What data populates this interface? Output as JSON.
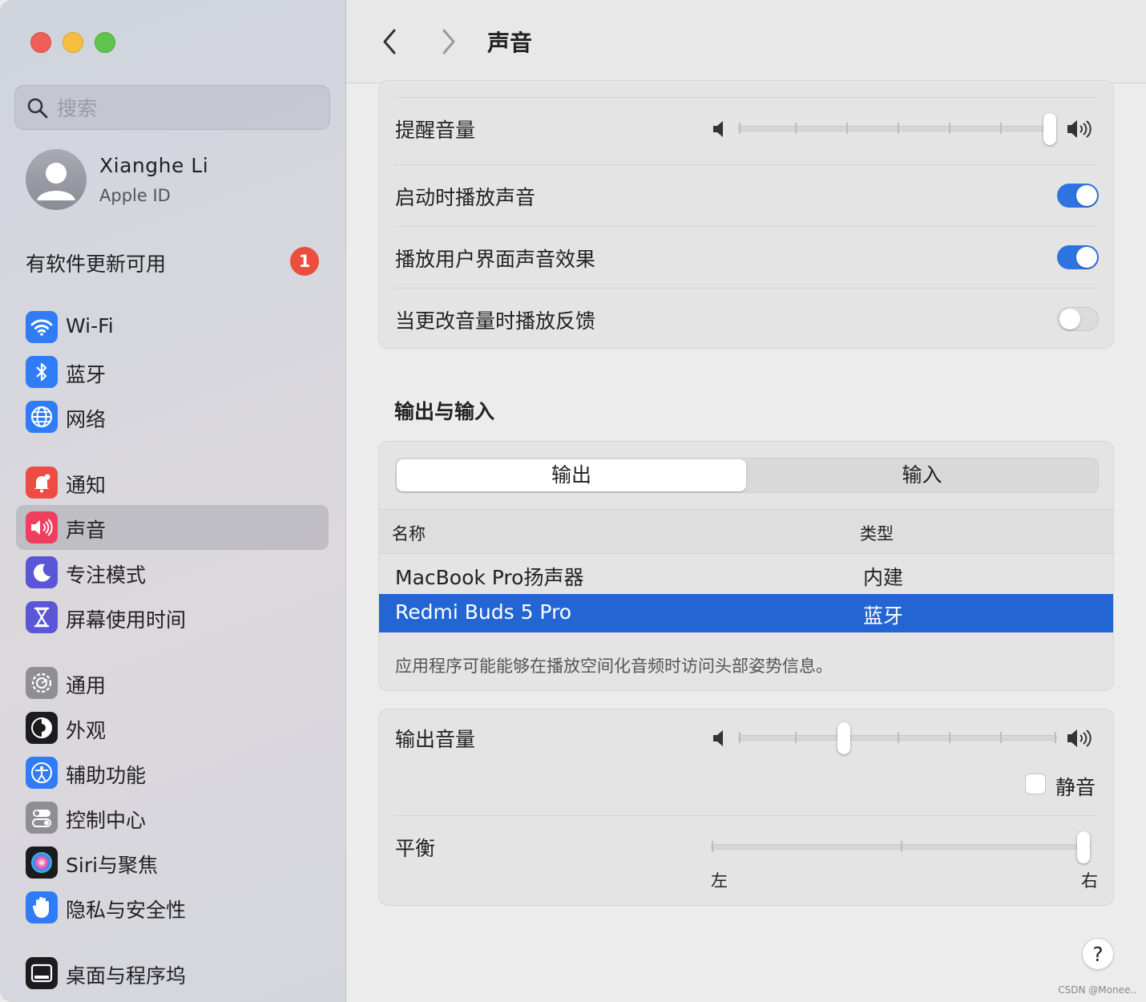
{
  "window": {
    "traffic_lights": [
      "close",
      "minimize",
      "zoom"
    ]
  },
  "sidebar": {
    "search_placeholder": "搜索",
    "account": {
      "name": "Xianghe  Li",
      "subtitle": "Apple ID"
    },
    "update": {
      "label": "有软件更新可用",
      "badge": "1"
    },
    "items": [
      {
        "label": "Wi-Fi",
        "icon": "wifi-icon",
        "color": "#2f7cf6"
      },
      {
        "label": "蓝牙",
        "icon": "bluetooth-icon",
        "color": "#2f7cf6"
      },
      {
        "label": "网络",
        "icon": "globe-icon",
        "color": "#2f7cf6"
      },
      {
        "label": "通知",
        "icon": "bell-icon",
        "color": "#ef4b45"
      },
      {
        "label": "声音",
        "icon": "speaker-icon",
        "color": "#ef3f5f",
        "selected": true
      },
      {
        "label": "专注模式",
        "icon": "moon-icon",
        "color": "#5b56d6"
      },
      {
        "label": "屏幕使用时间",
        "icon": "hourglass-icon",
        "color": "#5b56d6"
      },
      {
        "label": "通用",
        "icon": "gear-icon",
        "color": "#8e8e93"
      },
      {
        "label": "外观",
        "icon": "appearance-icon",
        "color": "#1c1c1e"
      },
      {
        "label": "辅助功能",
        "icon": "accessibility-icon",
        "color": "#2f7cf6"
      },
      {
        "label": "控制中心",
        "icon": "switches-icon",
        "color": "#8e8e93"
      },
      {
        "label": "Siri与聚焦",
        "icon": "siri-icon",
        "color": "#1c1c1e"
      },
      {
        "label": "隐私与安全性",
        "icon": "hand-icon",
        "color": "#2f7cf6"
      },
      {
        "label": "桌面与程序坞",
        "icon": "dock-icon",
        "color": "#1c1c1e"
      }
    ]
  },
  "header": {
    "title": "声音"
  },
  "alerts_card": {
    "alert_volume_label": "提醒音量",
    "alert_volume_level": 1.0,
    "rows": [
      {
        "label": "启动时播放声音",
        "on": true
      },
      {
        "label": "播放用户界面声音效果",
        "on": true
      },
      {
        "label": "当更改音量时播放反馈",
        "on": false
      }
    ]
  },
  "output_input": {
    "section_title": "输出与输入",
    "tabs": [
      "输出",
      "输入"
    ],
    "active_tab": "输出",
    "columns": [
      "名称",
      "类型"
    ],
    "devices": [
      {
        "name": "MacBook Pro扬声器",
        "type": "内建",
        "selected": false
      },
      {
        "name": "Redmi Buds 5 Pro",
        "type": "蓝牙",
        "selected": true
      }
    ],
    "note": "应用程序可能能够在播放空间化音频时访问头部姿势信息。"
  },
  "volume_card": {
    "output_volume_label": "输出音量",
    "output_volume_level": 0.33,
    "mute_label": "静音",
    "muted": false,
    "balance_label": "平衡",
    "balance_value": 1.0,
    "balance_left": "左",
    "balance_right": "右"
  },
  "help_label": "?",
  "watermark": "CSDN @Monee.."
}
